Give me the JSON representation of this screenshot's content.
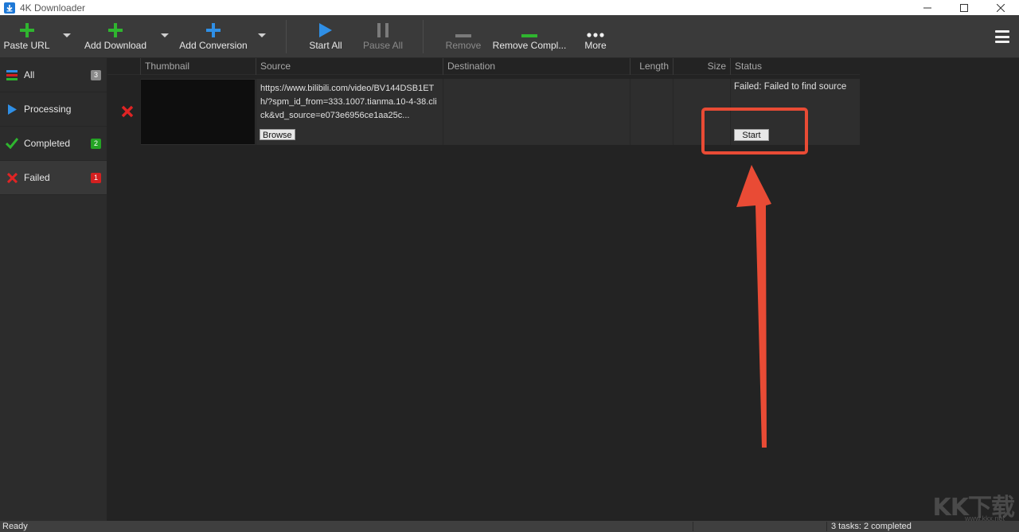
{
  "window": {
    "title": "4K Downloader",
    "icon": "download-app-icon",
    "controls": [
      "minimize-icon",
      "maximize-icon",
      "close-icon"
    ]
  },
  "toolbar": {
    "paste_url": "Paste URL",
    "add_download": "Add Download",
    "add_conversion": "Add Conversion",
    "start_all": "Start All",
    "pause_all": "Pause All",
    "remove": "Remove",
    "remove_completed": "Remove Compl...",
    "more": "More",
    "colors": {
      "add": "#2fb52f",
      "conversion": "#2f8fe6",
      "start": "#2f8fe6",
      "remove_completed": "#2fb52f",
      "disabled": "#7a7a7a"
    }
  },
  "sidebar": {
    "items": [
      {
        "label": "All",
        "count": "3",
        "badge_color": "#8a8a8a",
        "icon": "list-icon"
      },
      {
        "label": "Processing",
        "count": "",
        "badge_color": "",
        "icon": "play-icon"
      },
      {
        "label": "Completed",
        "count": "2",
        "badge_color": "#24a324",
        "icon": "check-icon"
      },
      {
        "label": "Failed",
        "count": "1",
        "badge_color": "#d32020",
        "icon": "x-icon"
      }
    ]
  },
  "table": {
    "columns": [
      "Thumbnail",
      "Source",
      "Destination",
      "Length",
      "Size",
      "Status"
    ],
    "rows": [
      {
        "source": "https://www.bilibili.com/video/BV144DSB1ETh/?spm_id_from=333.1007.tianma.10-4-38.click&vd_source=e073e6956ce1aa25c...",
        "browse": "Browse",
        "destination": "",
        "length": "",
        "size": "",
        "status": "Failed: Failed to find source",
        "start": "Start"
      }
    ]
  },
  "annotation": {
    "color": "#e94b35"
  },
  "statusbar": {
    "left": "Ready",
    "right": "3 tasks: 2 completed"
  },
  "watermark": {
    "text": "KK下载",
    "url": "www.kkx.net"
  }
}
